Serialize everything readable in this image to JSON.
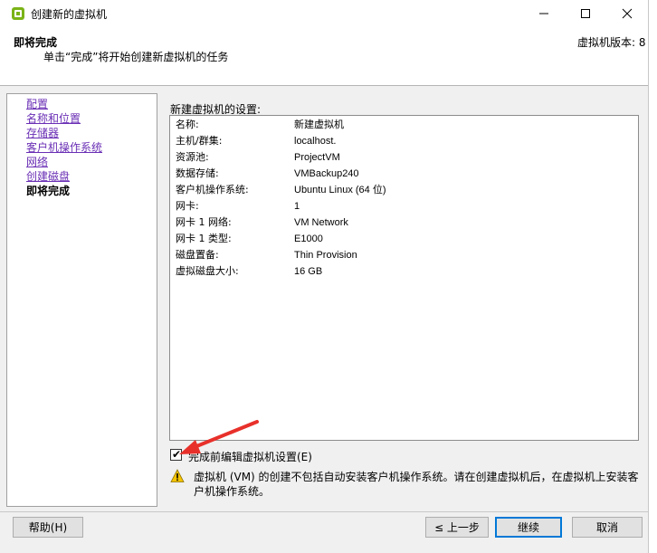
{
  "window": {
    "title": "创建新的虚拟机",
    "minimize": "—",
    "maximize": "☐",
    "close": "✕"
  },
  "header": {
    "title": "即将完成",
    "subtitle": "单击“完成”将开始创建新虚拟机的任务",
    "version": "虚拟机版本: 8"
  },
  "nav": {
    "items": [
      {
        "label": "配置",
        "visited": true
      },
      {
        "label": "名称和位置",
        "visited": true
      },
      {
        "label": "存储器",
        "visited": true
      },
      {
        "label": "客户机操作系统",
        "visited": true
      },
      {
        "label": "网络",
        "visited": true
      },
      {
        "label": "创建磁盘",
        "visited": true
      },
      {
        "label": "即将完成",
        "visited": false,
        "current": true
      }
    ]
  },
  "content": {
    "section_label": "新建虚拟机的设置:",
    "settings": [
      {
        "key": "名称:",
        "value": "新建虚拟机"
      },
      {
        "key": "主机/群集:",
        "value": "localhost."
      },
      {
        "key": "资源池:",
        "value": "ProjectVM"
      },
      {
        "key": "数据存储:",
        "value": "VMBackup240"
      },
      {
        "key": "客户机操作系统:",
        "value": "Ubuntu Linux (64 位)"
      },
      {
        "key": "网卡:",
        "value": "1"
      },
      {
        "key": "网卡 1 网络:",
        "value": "VM Network"
      },
      {
        "key": "网卡 1 类型:",
        "value": "E1000"
      },
      {
        "key": "磁盘置备:",
        "value": "Thin Provision"
      },
      {
        "key": "虚拟磁盘大小:",
        "value": "16 GB"
      }
    ],
    "edit_before_complete": {
      "label": "完成前编辑虚拟机设置(E)",
      "checked": true
    },
    "warning": "虚拟机 (VM) 的创建不包括自动安装客户机操作系统。请在创建虚拟机后，在虚拟机上安装客户机操作系统。"
  },
  "buttons": {
    "help": "帮助(H)",
    "back": "≤ 上一步",
    "next": "继续",
    "cancel": "取消"
  },
  "colors": {
    "link": "#6a2fb5",
    "accent": "#0078d7",
    "arrow": "#e8302a",
    "warning": "#f5c400"
  }
}
